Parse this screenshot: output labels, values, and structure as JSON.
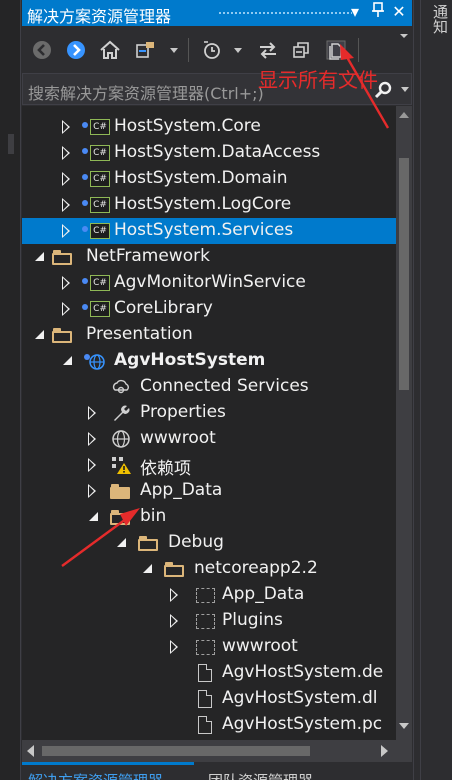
{
  "window": {
    "title": "解决方案资源管理器",
    "pin_glyph": "▾",
    "autohide_glyph": "⊥",
    "close_glyph": "✕"
  },
  "right_panel": {
    "label": "通知"
  },
  "toolbar": {
    "buttons": [
      "back-icon",
      "forward-icon",
      "home-icon",
      "switch-views-icon",
      "pending-changes-filter-icon",
      "sync-icon",
      "collapse-all-icon",
      "show-all-files-icon"
    ]
  },
  "search": {
    "placeholder": "搜索解决方案资源管理器(Ctrl+;)"
  },
  "annotation": {
    "text": "显示所有文件",
    "color": "#e52b2b"
  },
  "tree": {
    "items": [
      {
        "label": "HostSystem.Core",
        "icon": "csharp-project-icon",
        "expanded": false
      },
      {
        "label": "HostSystem.DataAccess",
        "icon": "csharp-project-icon",
        "expanded": false
      },
      {
        "label": "HostSystem.Domain",
        "icon": "csharp-project-icon",
        "expanded": false
      },
      {
        "label": "HostSystem.LogCore",
        "icon": "csharp-project-icon",
        "expanded": false
      },
      {
        "label": "HostSystem.Services",
        "icon": "csharp-project-icon",
        "expanded": false,
        "selected": true
      },
      {
        "label": "NetFramework",
        "icon": "solution-folder-icon",
        "expanded": true
      },
      {
        "label": "AgvMonitorWinService",
        "icon": "csharp-project-icon",
        "expanded": false
      },
      {
        "label": "CoreLibrary",
        "icon": "csharp-project-icon",
        "expanded": false
      },
      {
        "label": "Presentation",
        "icon": "solution-folder-icon",
        "expanded": true
      },
      {
        "label": "AgvHostSystem",
        "icon": "web-project-icon",
        "expanded": true
      },
      {
        "label": "Connected Services",
        "icon": "connected-services-icon"
      },
      {
        "label": "Properties",
        "icon": "wrench-icon",
        "expanded": false
      },
      {
        "label": "wwwroot",
        "icon": "globe-icon",
        "expanded": false
      },
      {
        "label": "依赖项",
        "icon": "dependencies-warning-icon",
        "expanded": false
      },
      {
        "label": "App_Data",
        "icon": "folder-icon",
        "expanded": false
      },
      {
        "label": "bin",
        "icon": "folder-icon",
        "expanded": true
      },
      {
        "label": "Debug",
        "icon": "folder-icon",
        "expanded": true
      },
      {
        "label": "netcoreapp2.2",
        "icon": "folder-icon",
        "expanded": true
      },
      {
        "label": "App_Data",
        "icon": "excluded-folder-icon",
        "expanded": false
      },
      {
        "label": "Plugins",
        "icon": "excluded-folder-icon",
        "expanded": false
      },
      {
        "label": "wwwroot",
        "icon": "excluded-folder-icon",
        "expanded": false
      },
      {
        "label": "AgvHostSystem.de",
        "icon": "file-icon"
      },
      {
        "label": "AgvHostSystem.dl",
        "icon": "file-icon"
      },
      {
        "label": "AgvHostSystem.pc",
        "icon": "file-icon"
      }
    ]
  },
  "bottom_tabs": {
    "active": "解决方案资源管理器",
    "other": "团队资源管理器"
  },
  "colors": {
    "accent": "#007acc",
    "background": "#252526",
    "annotation": "#e52b2b"
  }
}
